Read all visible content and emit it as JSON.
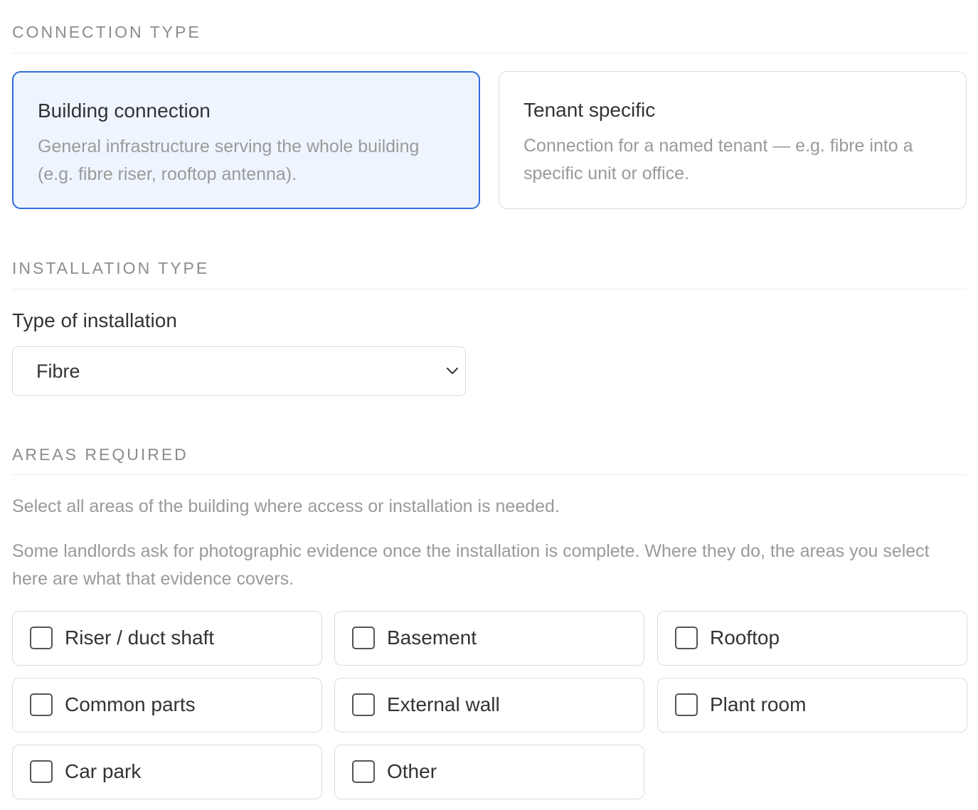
{
  "connection": {
    "heading": "CONNECTION TYPE",
    "options": [
      {
        "title": "Building connection",
        "description": "General infrastructure serving the whole building (e.g. fibre riser, rooftop antenna).",
        "selected": true
      },
      {
        "title": "Tenant specific",
        "description": "Connection for a named tenant — e.g. fibre into a specific unit or office.",
        "selected": false
      }
    ]
  },
  "installation": {
    "heading": "INSTALLATION TYPE",
    "label": "Type of installation",
    "selected_value": "Fibre"
  },
  "areas": {
    "heading": "AREAS REQUIRED",
    "help1": "Select all areas of the building where access or installation is needed.",
    "help2": "Some landlords ask for photographic evidence once the installation is complete. Where they do, the areas you select here are what that evidence covers.",
    "items": [
      {
        "label": "Riser / duct shaft",
        "checked": false
      },
      {
        "label": "Basement",
        "checked": false
      },
      {
        "label": "Rooftop",
        "checked": false
      },
      {
        "label": "Common parts",
        "checked": false
      },
      {
        "label": "External wall",
        "checked": false
      },
      {
        "label": "Plant room",
        "checked": false
      },
      {
        "label": "Car park",
        "checked": false
      },
      {
        "label": "Other",
        "checked": false
      }
    ]
  },
  "colors": {
    "accent": "#2f6bd9",
    "selected_bg": "#eef5ff",
    "muted_text": "#9a9a9a",
    "border": "#dcdcdc"
  }
}
